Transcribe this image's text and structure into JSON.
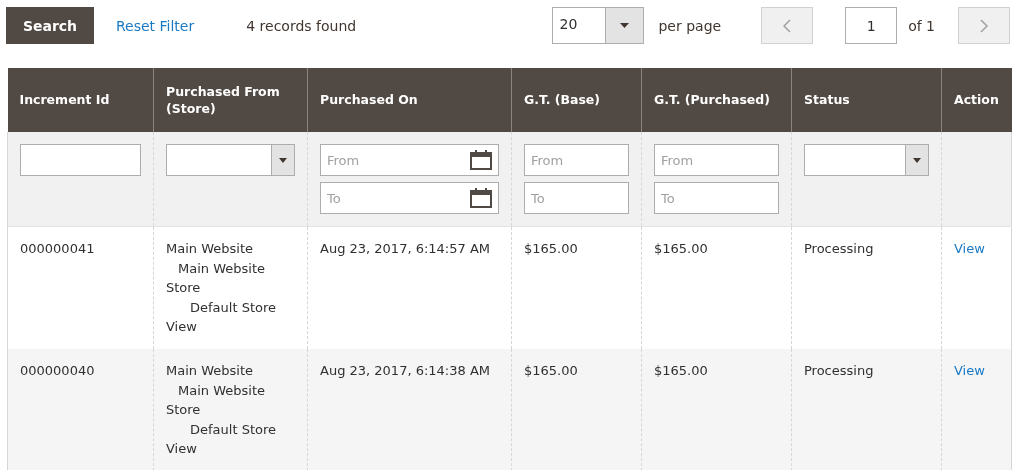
{
  "toolbar": {
    "search_button": "Search",
    "reset_link": "Reset Filter",
    "records_found": "4 records found",
    "per_page": {
      "value": "20",
      "label": "per page"
    },
    "pager": {
      "page": "1",
      "total": "of 1"
    }
  },
  "table": {
    "columns": [
      {
        "label": "Increment Id",
        "filter": {
          "kind": "text"
        }
      },
      {
        "label": "Purchased From (Store)",
        "filter": {
          "kind": "select"
        }
      },
      {
        "label": "Purchased On",
        "filter": {
          "kind": "date_range",
          "from_placeholder": "From",
          "to_placeholder": "To"
        }
      },
      {
        "label": "G.T. (Base)",
        "filter": {
          "kind": "range",
          "from_placeholder": "From",
          "to_placeholder": "To"
        }
      },
      {
        "label": "G.T. (Purchased)",
        "filter": {
          "kind": "range",
          "from_placeholder": "From",
          "to_placeholder": "To"
        }
      },
      {
        "label": "Status",
        "filter": {
          "kind": "select"
        }
      },
      {
        "label": "Action",
        "filter": {
          "kind": "none"
        }
      }
    ],
    "rows": [
      {
        "increment_id": "000000041",
        "store": [
          {
            "name": "Main Website",
            "children": [
              {
                "name": "Main Website Store",
                "children": [
                  {
                    "name": "Default Store View"
                  }
                ]
              }
            ]
          }
        ],
        "purchased_on": "Aug 23, 2017, 6:14:57 AM",
        "gt_base": "$165.00",
        "gt_purchased": "$165.00",
        "status": "Processing",
        "action": "View"
      },
      {
        "increment_id": "000000040",
        "store": [
          {
            "name": "Main Website",
            "children": [
              {
                "name": "Main Website Store",
                "children": [
                  {
                    "name": "Default Store View"
                  }
                ]
              }
            ]
          }
        ],
        "purchased_on": "Aug 23, 2017, 6:14:38 AM",
        "gt_base": "$165.00",
        "gt_purchased": "$165.00",
        "status": "Processing",
        "action": "View"
      }
    ]
  }
}
